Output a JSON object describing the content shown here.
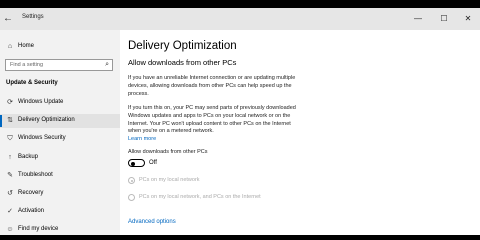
{
  "window": {
    "title": "Settings",
    "back_icon": "back-arrow-icon",
    "controls": {
      "minimize": "—",
      "maximize": "☐",
      "close": "✕"
    }
  },
  "sidebar": {
    "home": {
      "label": "Home",
      "icon": "home-icon"
    },
    "search": {
      "placeholder": "Find a setting",
      "icon": "search-icon"
    },
    "section_title": "Update & Security",
    "items": [
      {
        "label": "Windows Update",
        "icon": "refresh-icon",
        "active": false
      },
      {
        "label": "Delivery Optimization",
        "icon": "delivery-icon",
        "active": true
      },
      {
        "label": "Windows Security",
        "icon": "shield-icon",
        "active": false
      },
      {
        "label": "Backup",
        "icon": "upload-icon",
        "active": false
      },
      {
        "label": "Troubleshoot",
        "icon": "wrench-icon",
        "active": false
      },
      {
        "label": "Recovery",
        "icon": "recovery-icon",
        "active": false
      },
      {
        "label": "Activation",
        "icon": "check-circle-icon",
        "active": false
      },
      {
        "label": "Find my device",
        "icon": "person-location-icon",
        "active": false
      }
    ]
  },
  "main": {
    "title": "Delivery Optimization",
    "subtitle": "Allow downloads from other PCs",
    "para1": "If you have an unreliable Internet connection or are updating multiple devices, allowing downloads from other PCs can help speed up the process.",
    "para2": "If you turn this on, your PC may send parts of previously downloaded Windows updates and apps to PCs on your local network or on the Internet. Your PC won't upload content to other PCs on the Internet when you're on a metered network.",
    "learn_more": "Learn more",
    "toggle": {
      "label": "Allow downloads from other PCs",
      "state": "Off",
      "on": false
    },
    "radio_options": [
      {
        "label": "PCs on my local network",
        "selected": true,
        "enabled": false
      },
      {
        "label": "PCs on my local network, and PCs on the Internet",
        "selected": false,
        "enabled": false
      }
    ],
    "advanced_link": "Advanced options"
  },
  "colors": {
    "accent": "#0067c0",
    "sidebar_bg": "#f2f2f2",
    "titlebar_bg": "#e6e6e6",
    "disabled_text": "#aaaaaa"
  }
}
